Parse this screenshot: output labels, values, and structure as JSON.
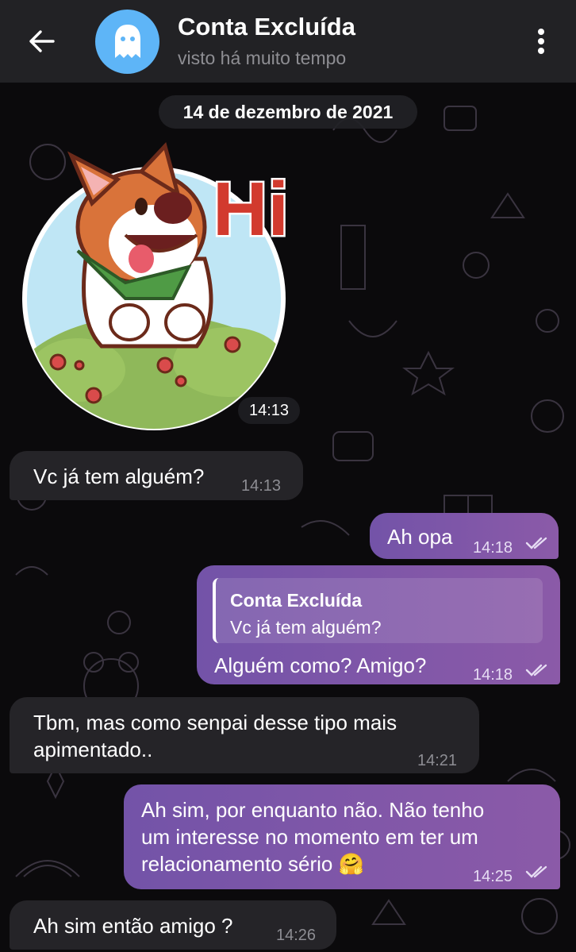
{
  "header": {
    "title": "Conta Excluída",
    "subtitle": "visto há muito tempo"
  },
  "date_separator": "14 de dezembro de 2021",
  "sticker": {
    "text": "Hi",
    "time": "14:13"
  },
  "messages": [
    {
      "direction": "in",
      "text": "Vc já tem alguém?",
      "time": "14:13"
    },
    {
      "direction": "out",
      "text": "Ah opa",
      "time": "14:18",
      "read": true
    },
    {
      "direction": "out",
      "reply_to": {
        "author": "Conta Excluída",
        "text": "Vc já tem alguém?"
      },
      "text": "Alguém como? Amigo?",
      "time": "14:18",
      "read": true
    },
    {
      "direction": "in",
      "lines": [
        "Tbm, mas como senpai desse tipo mais",
        "apimentado.."
      ],
      "time": "14:21"
    },
    {
      "direction": "out",
      "lines": [
        "Ah sim, por enquanto não. Não tenho",
        "um interesse no momento em ter um",
        "relacionamento sério 🤗"
      ],
      "time": "14:25",
      "read": true
    },
    {
      "direction": "in",
      "text": "Ah sim então amigo ?",
      "time": "14:26"
    }
  ],
  "icons": {
    "back": "arrow-left-icon",
    "avatar": "ghost-icon",
    "menu": "more-vertical-icon",
    "read": "double-check-icon"
  },
  "colors": {
    "header_bg": "#222225",
    "incoming_bubble": "#252428",
    "outgoing_bubble": "#7d57a8",
    "avatar_bg": "#5eb5f7"
  }
}
